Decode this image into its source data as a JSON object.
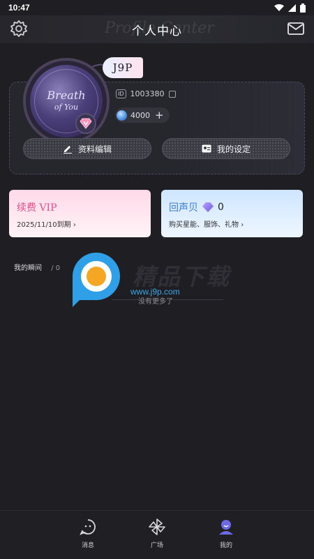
{
  "status_bar": {
    "time": "10:47"
  },
  "header": {
    "title": "个人中心",
    "watermark": "Profile Center",
    "settings_icon": "gear-icon",
    "mail_icon": "mail-icon"
  },
  "profile": {
    "avatar_text_line1": "Breath",
    "avatar_text_line2": "of You",
    "name": "J9P",
    "id_label": "ID",
    "id_value": "1003380",
    "coins": "4000",
    "edit_button": "资料编辑",
    "settings_button": "我的设定"
  },
  "vip_card": {
    "title": "续费 VIP",
    "subtitle": "2025/11/10到期"
  },
  "echo_card": {
    "title": "回声贝",
    "count": "0",
    "subtitle": "购买星能、服饰、礼物"
  },
  "moments": {
    "label": "我的瞬间",
    "count": "/ 0",
    "empty_note": "没有更多了"
  },
  "watermark": {
    "text": "精品下载",
    "url": "www.j9p.com"
  },
  "bottom_nav": {
    "items": [
      {
        "label": "消息",
        "icon": "chat-bubble-icon"
      },
      {
        "label": "广场",
        "icon": "pinwheel-icon"
      },
      {
        "label": "我的",
        "icon": "user-icon"
      }
    ]
  },
  "colors": {
    "background": "#1f1f23",
    "vip_accent": "#e24f8c",
    "echo_accent": "#3a7bd5",
    "nav_active": "#6d6ae8"
  }
}
